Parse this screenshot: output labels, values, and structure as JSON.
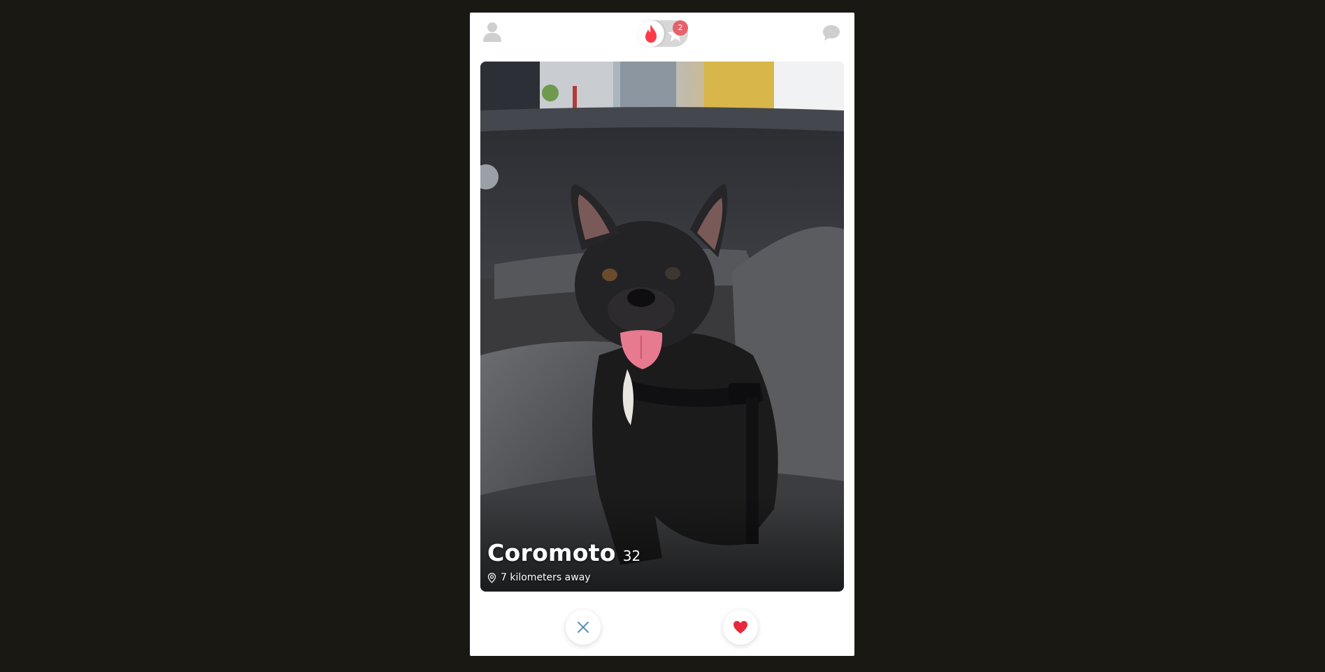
{
  "header": {
    "notification_count": "2",
    "profile_icon": "person-icon",
    "mode_icons": [
      "flame-icon",
      "star-icon"
    ],
    "messages_icon": "chat-bubble-icon"
  },
  "card": {
    "name": "Coromoto",
    "age": "32",
    "distance": "7 kilometers away",
    "photo": "french-bulldog-in-car-seat"
  },
  "actions": {
    "nope_icon": "close-icon",
    "like_icon": "heart-icon"
  },
  "colors": {
    "brand": "#fd3a4a",
    "badge": "#e8606a",
    "nope": "#5b8fb9",
    "like": "#e8293c",
    "page_background": "#1a1813"
  }
}
